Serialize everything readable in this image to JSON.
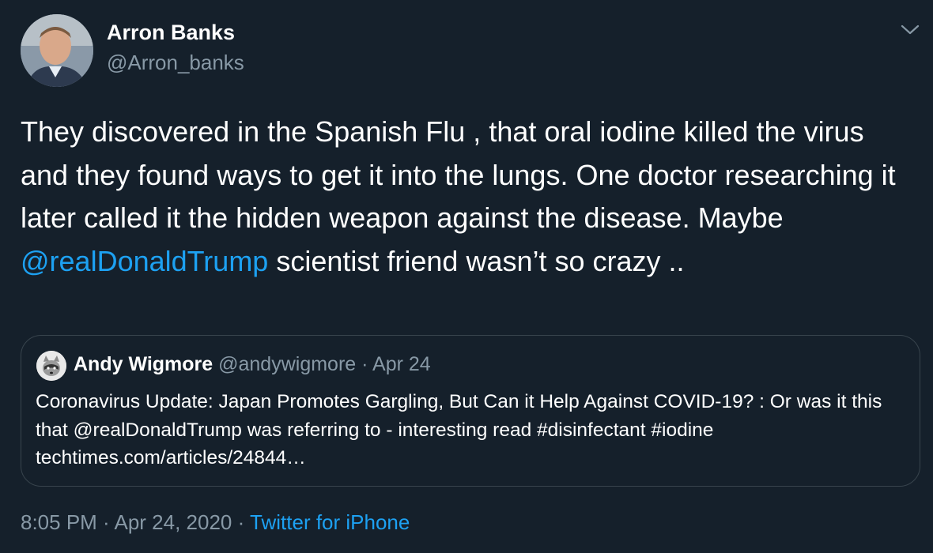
{
  "author": {
    "name": "Arron Banks",
    "handle": "@Arron_banks",
    "avatar_icon": "person-photo-avatar"
  },
  "tweet": {
    "text_1": "They discovered in the Spanish Flu , that oral iodine killed the virus and they found ways to get it into the lungs. One doctor researching it later called it the hidden weapon against the disease. Maybe ",
    "mention": "@realDonaldTrump",
    "text_2": " scientist friend wasn’t so crazy .."
  },
  "quoted": {
    "name": "Andy Wigmore",
    "handle": "@andywigmore",
    "separator": " · ",
    "date": "Apr 24",
    "avatar_icon": "raccoon-avatar",
    "text": "Coronavirus Update: Japan Promotes Gargling, But Can it Help Against COVID-19? : Or was it this that @realDonaldTrump was referring to - interesting read #disinfectant #iodine  techtimes.com/articles/24844…"
  },
  "footer": {
    "time": "8:05 PM",
    "separator": " · ",
    "date": "Apr 24, 2020",
    "separator2": " · ",
    "source": "Twitter for iPhone"
  },
  "menu_icon": "chevron-down-icon",
  "colors": {
    "background": "#15202b",
    "text": "#ffffff",
    "secondary": "#8899a6",
    "link": "#1da1f2",
    "border": "#38444d"
  }
}
